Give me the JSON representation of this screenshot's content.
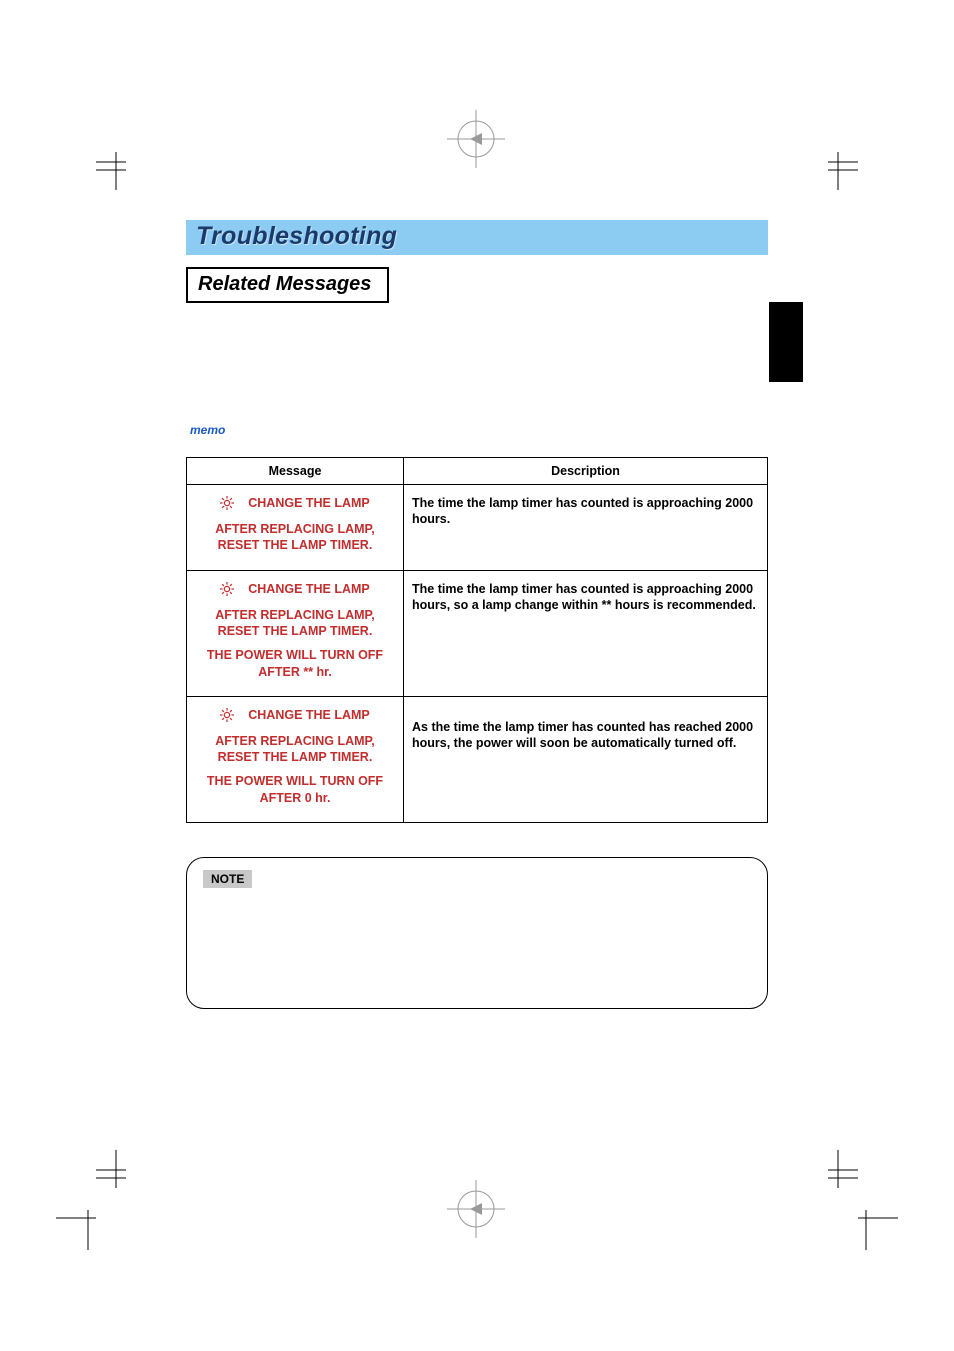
{
  "heading": "Troubleshooting",
  "sub_heading": "Related Messages",
  "memo_label": "memo",
  "table": {
    "headers": {
      "message": "Message",
      "description": "Description"
    },
    "rows": [
      {
        "msg_l1": "CHANGE THE LAMP",
        "msg_l2": "AFTER REPLACING LAMP,",
        "msg_l3": "RESET THE LAMP TIMER.",
        "msg_l4": "",
        "msg_l5": "",
        "desc": "The time the lamp timer has counted is approaching 2000 hours."
      },
      {
        "msg_l1": "CHANGE THE LAMP",
        "msg_l2": "AFTER REPLACING LAMP,",
        "msg_l3": "RESET THE LAMP TIMER.",
        "msg_l4": "THE POWER WILL TURN OFF",
        "msg_l5": "AFTER ** hr.",
        "desc": "The time the lamp timer has counted is approaching 2000 hours, so a lamp change within ** hours is recommended."
      },
      {
        "msg_l1": "CHANGE THE LAMP",
        "msg_l2": "AFTER REPLACING LAMP,",
        "msg_l3": "RESET THE LAMP TIMER.",
        "msg_l4": "THE POWER WILL TURN OFF",
        "msg_l5": "AFTER 0 hr.",
        "desc": "As the time the lamp timer has counted has reached 2000 hours, the power will soon be automatically turned off."
      }
    ]
  },
  "note_label": "NOTE"
}
